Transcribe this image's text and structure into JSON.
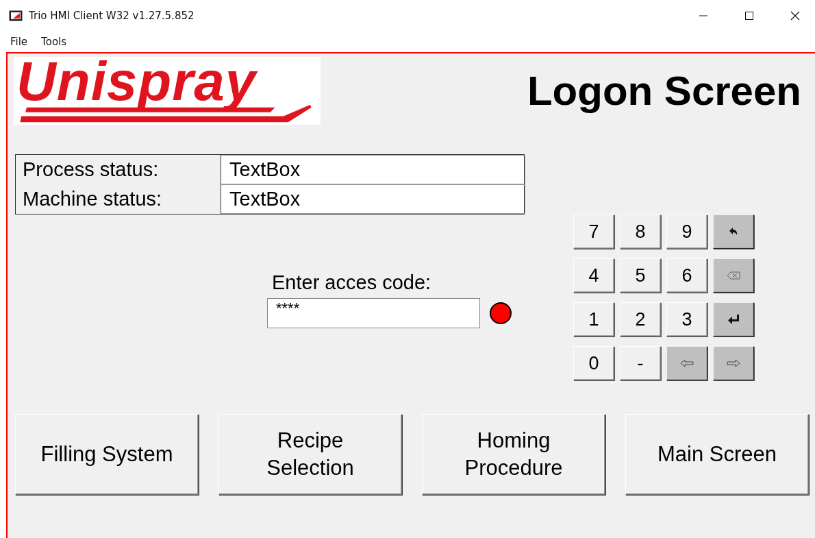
{
  "window": {
    "title": "Trio HMI Client W32 v1.27.5.852"
  },
  "menu": [
    "File",
    "Tools"
  ],
  "logo": {
    "text": "Unispray"
  },
  "screen_title": "Logon Screen",
  "status": [
    {
      "label": "Process status:",
      "value": "TextBox"
    },
    {
      "label": "Machine status:",
      "value": "TextBox"
    }
  ],
  "access": {
    "label": "Enter acces code:",
    "value": "****",
    "indicators": [
      {
        "color": "#ff0000"
      }
    ]
  },
  "keypad": [
    {
      "kind": "digit",
      "label": "7"
    },
    {
      "kind": "digit",
      "label": "8"
    },
    {
      "kind": "digit",
      "label": "9"
    },
    {
      "kind": "undo"
    },
    {
      "kind": "digit",
      "label": "4"
    },
    {
      "kind": "digit",
      "label": "5"
    },
    {
      "kind": "digit",
      "label": "6"
    },
    {
      "kind": "backspace"
    },
    {
      "kind": "digit",
      "label": "1"
    },
    {
      "kind": "digit",
      "label": "2"
    },
    {
      "kind": "digit",
      "label": "3"
    },
    {
      "kind": "enter"
    },
    {
      "kind": "digit",
      "label": "0"
    },
    {
      "kind": "digit",
      "label": "-"
    },
    {
      "kind": "left"
    },
    {
      "kind": "right"
    }
  ],
  "nav_buttons": [
    "Filling System",
    "Recipe Selection",
    "Homing Procedure",
    "Main Screen"
  ]
}
